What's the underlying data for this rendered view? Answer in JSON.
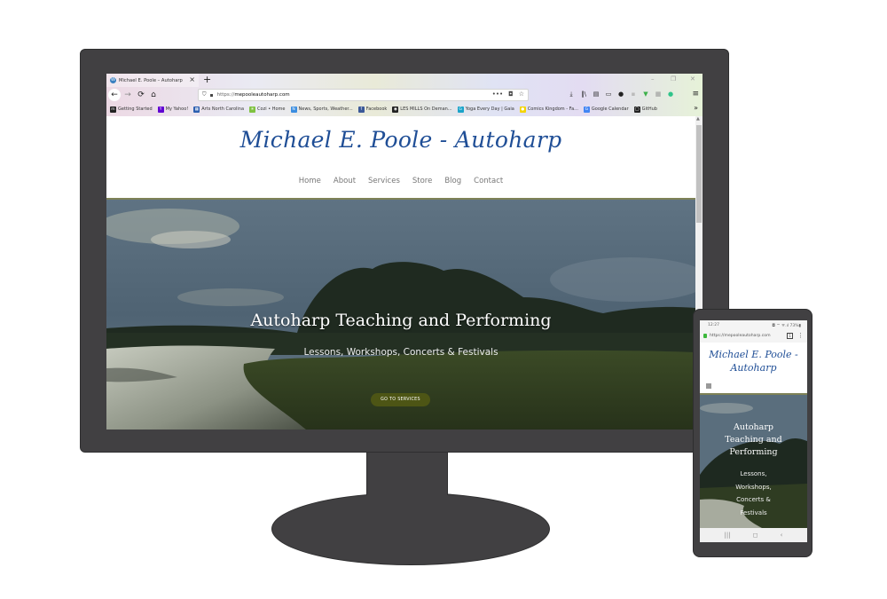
{
  "desktop": {
    "browser": {
      "tab": {
        "favicon": "wordpress-icon",
        "title": "Michael E. Poole – Autoharp",
        "close": "×"
      },
      "new_tab": "+",
      "window_controls": [
        "–",
        "❐",
        "✕"
      ],
      "nav": {
        "back": "←",
        "forward": "→",
        "reload": "⟳",
        "home": "⌂"
      },
      "url": {
        "prefix": "https://",
        "domain": "mepooleautoharp.com",
        "shield_icon": "⛉",
        "lock_icon": "🔒",
        "page_actions": [
          "•••",
          "◘",
          "☆"
        ]
      },
      "toolbar_icons": [
        {
          "name": "downloads-icon",
          "glyph": "⤓"
        },
        {
          "name": "library-icon",
          "glyph": "‖\\"
        },
        {
          "name": "print-icon",
          "glyph": "▤"
        },
        {
          "name": "sidebar-icon",
          "glyph": "▭"
        },
        {
          "name": "account-icon",
          "glyph": "●"
        },
        {
          "name": "extension-icon",
          "glyph": "▪"
        },
        {
          "name": "shield-extension-icon",
          "glyph": "▼"
        },
        {
          "name": "grid-extension-icon",
          "glyph": "▦"
        },
        {
          "name": "sync-extension-icon",
          "glyph": "●"
        }
      ],
      "menu": "≡",
      "bookmarks": [
        {
          "label": "Getting Started",
          "icon": "m",
          "color": "#222222"
        },
        {
          "label": "My Yahoo!",
          "icon": "Y",
          "color": "#6001d2"
        },
        {
          "label": "Arts North Carolina",
          "icon": "▦",
          "color": "#2c5fb0"
        },
        {
          "label": "Cozi • Home",
          "icon": "✳",
          "color": "#7fc241"
        },
        {
          "label": "News, Sports, Weather...",
          "icon": "N",
          "color": "#3b8de0"
        },
        {
          "label": "Facebook",
          "icon": "f",
          "color": "#3b5998"
        },
        {
          "label": "LES MILLS On Deman...",
          "icon": "◉",
          "color": "#222222"
        },
        {
          "label": "Yoga Every Day | Gaia",
          "icon": "G",
          "color": "#1aa3c9"
        },
        {
          "label": "Comics Kingdom - Fa...",
          "icon": "●",
          "color": "#f4d400"
        },
        {
          "label": "Google Calendar",
          "icon": "G",
          "color": "#4285f4"
        },
        {
          "label": "GitHub",
          "icon": "◯",
          "color": "#222222"
        }
      ],
      "bookmarks_more": "»"
    },
    "site": {
      "title": "Michael E. Poole - Autoharp",
      "nav": [
        "Home",
        "About",
        "Services",
        "Store",
        "Blog",
        "Contact"
      ],
      "hero": {
        "title": "Autoharp Teaching and Performing",
        "subtitle": "Lessons, Workshops, Concerts & Festivals",
        "button": "GO TO SERVICES"
      }
    }
  },
  "mobile": {
    "status": {
      "time": "12:27",
      "system": "◘ ⌔ ᯤ.ıl 73%▮"
    },
    "url": "https://mepooleautoharp.com",
    "tabs_count": "1",
    "more": "⋮",
    "site": {
      "title_line1": "Michael E. Poole -",
      "title_line2": "Autoharp",
      "hero_title_lines": [
        "Autoharp",
        "Teaching and",
        "Performing"
      ],
      "hero_sub_lines": [
        "Lessons,",
        "Workshops,",
        "Concerts &",
        "Festivals"
      ]
    },
    "navbar": [
      "|||",
      "◻",
      "‹"
    ]
  },
  "colors": {
    "frame": "#414042",
    "site_title": "#1f4e96",
    "accent_olive": "#4d5515",
    "header_border": "#7f8257"
  }
}
